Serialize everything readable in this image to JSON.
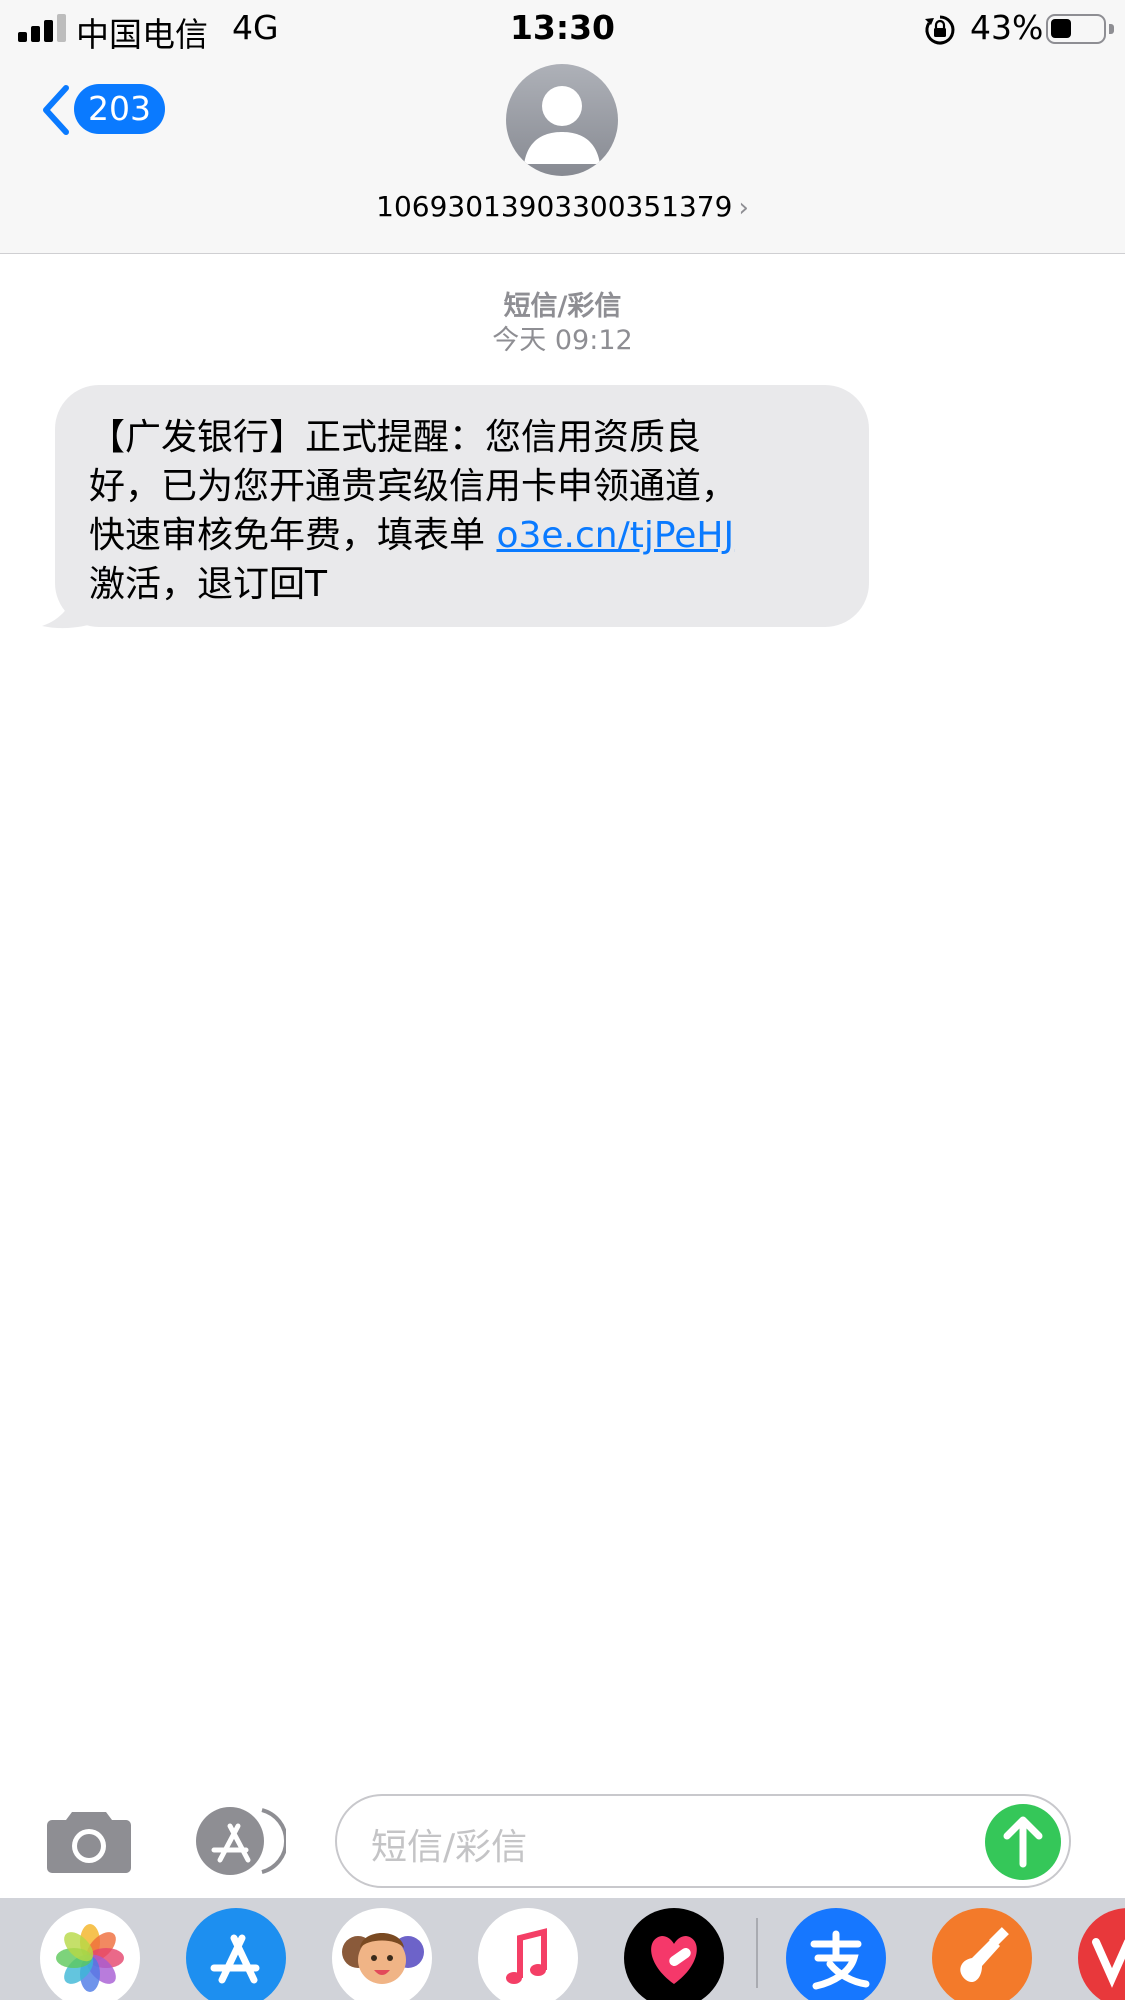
{
  "status_bar": {
    "carrier": "中国电信",
    "network": "4G",
    "time": "13:30",
    "battery_percent": "43%",
    "battery_level": 0.43,
    "signal_bars": 3
  },
  "header": {
    "back_badge_count": "203",
    "contact_number": "10693013903300351379",
    "chevron_glyph": "›",
    "avatar_icon": "person-icon"
  },
  "conversation": {
    "service_label": "短信/彩信",
    "timestamp": "今天 09:12",
    "message": {
      "text_line1": "【广发银行】正式提醒：您信用资质良",
      "text_line2": "好，已为您开通贵宾级信用卡申领通道，",
      "text_line3_prefix": "快速审核免年费，填表单 ",
      "link": "o3e.cn/tjPeHJ",
      "text_line4": "激活，退订回T"
    }
  },
  "input_bar": {
    "placeholder": "短信/彩信",
    "camera_icon": "camera-icon",
    "apps_icon": "app-store-icon",
    "send_icon": "send-arrow-icon"
  },
  "app_drawer": {
    "apps": [
      "photos-icon",
      "app-store-icon",
      "memoji-icon",
      "music-icon",
      "heart-app-icon",
      "alipay-icon",
      "garageband-icon",
      "red-app-icon"
    ]
  },
  "colors": {
    "accent": "#0a7aff",
    "bubble_gray": "#e9e9eb",
    "send_green": "#35c759",
    "meta_gray": "#8e8e93"
  }
}
